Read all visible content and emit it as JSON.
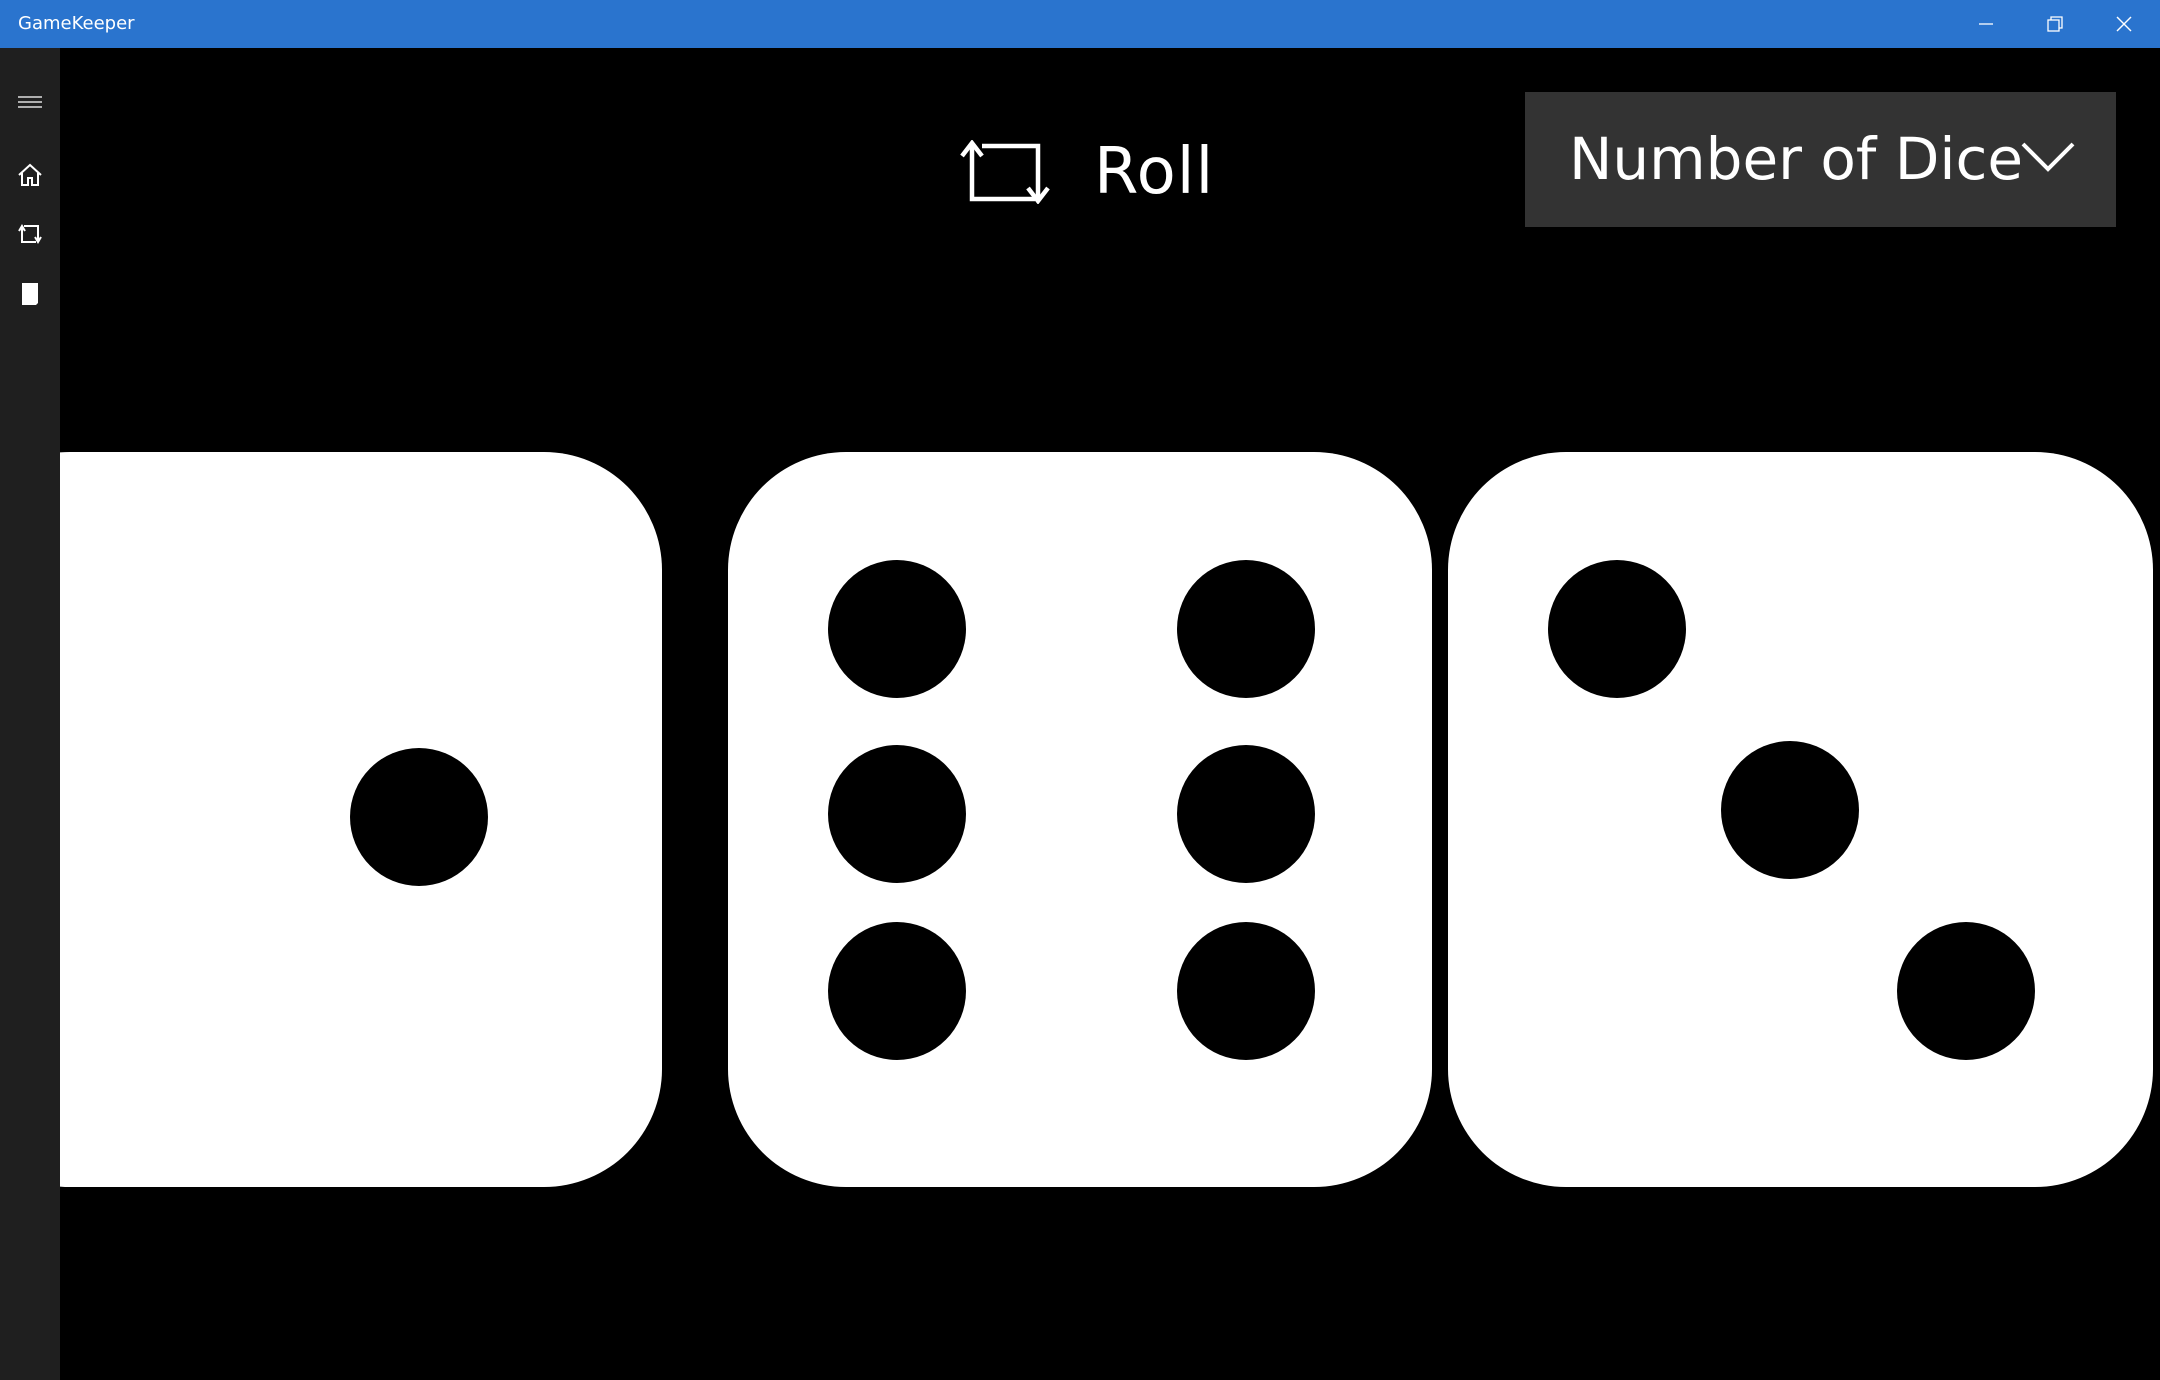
{
  "window": {
    "title": "GameKeeper",
    "titlebar_color": "#2a74ce",
    "controls": [
      "minimize-icon",
      "restore-icon",
      "close-icon"
    ]
  },
  "sidebar": {
    "background": "#1f1f1f",
    "items": [
      {
        "icon": "hamburger-menu-icon"
      },
      {
        "icon": "home-icon"
      },
      {
        "icon": "roll-icon"
      },
      {
        "icon": "page-icon"
      }
    ]
  },
  "toolbar": {
    "roll_label": "Roll",
    "roll_icon": "roll-arrows-icon",
    "dice_select": {
      "selected_label": "Number of Dice",
      "icon": "chevron-down-icon",
      "background": "#333333"
    }
  },
  "dice": [
    {
      "value": 1
    },
    {
      "value": 6
    },
    {
      "value": 3
    }
  ]
}
